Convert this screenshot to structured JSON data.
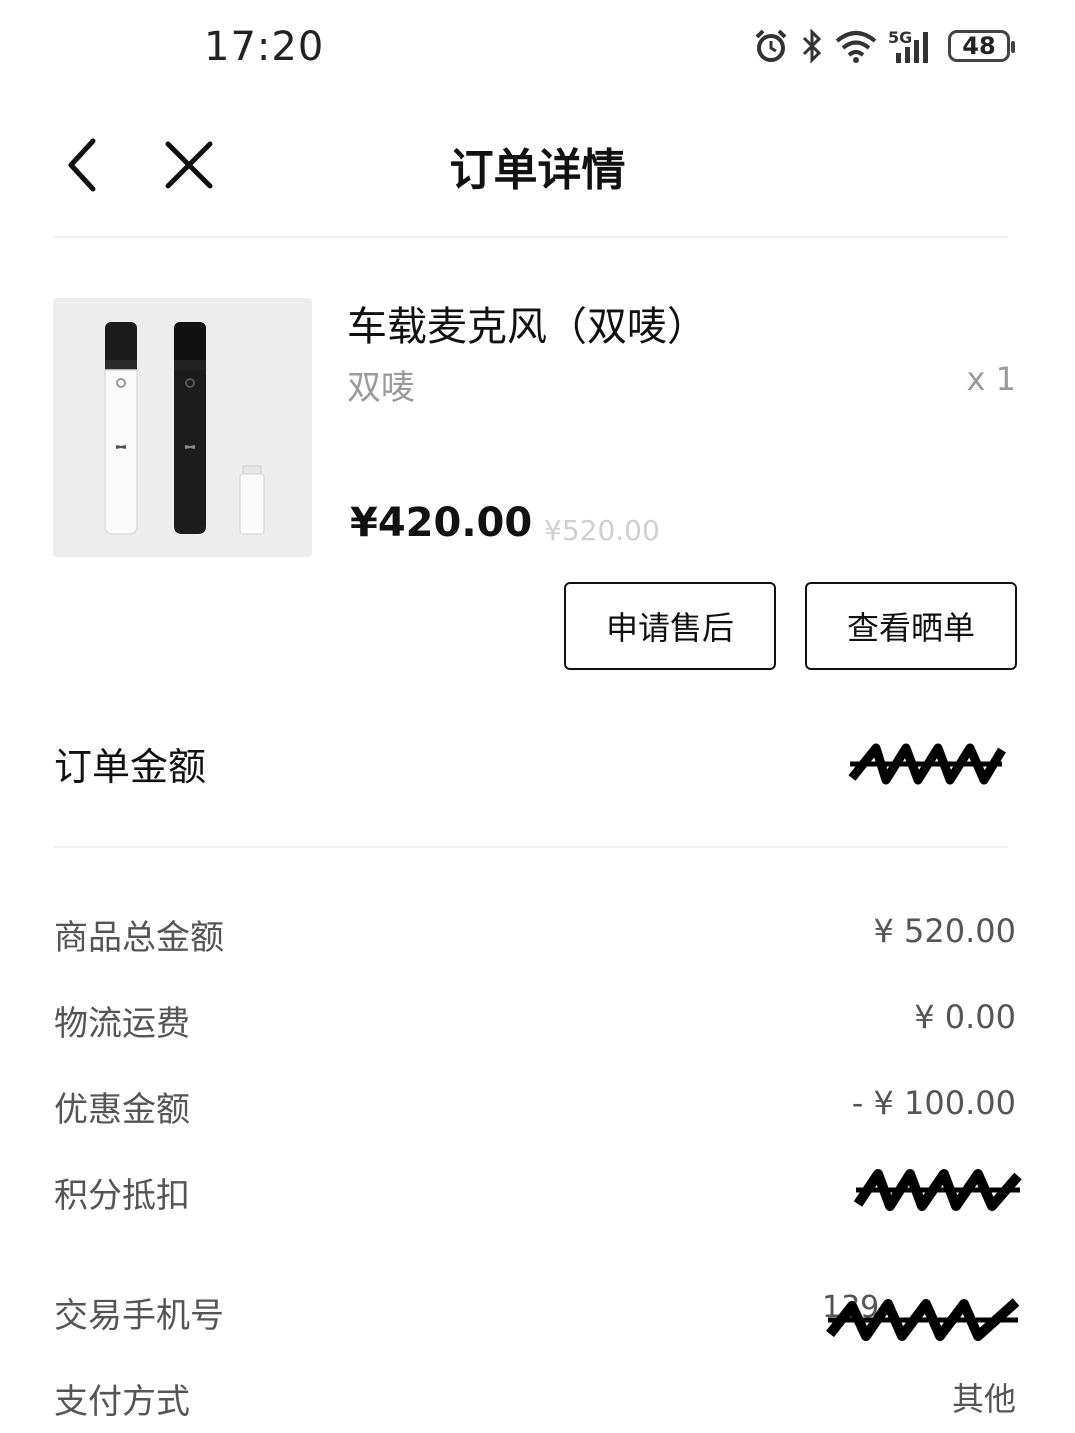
{
  "status_bar": {
    "time": "17:20",
    "network": "5G",
    "battery": "48",
    "icons": [
      "alarm-icon",
      "bluetooth-icon",
      "wifi-icon",
      "signal-icon",
      "battery-icon"
    ]
  },
  "header": {
    "title": "订单详情",
    "back_icon": "chevron-left-icon",
    "close_icon": "close-icon"
  },
  "product": {
    "name": "车载麦克风（双唛）",
    "variant": "双唛",
    "quantity": "x 1",
    "price": "¥420.00",
    "original_price": "¥520.00",
    "buttons": {
      "after_sale": "申请售后",
      "view_review": "查看晒单"
    }
  },
  "order_amount": {
    "label": "订单金额"
  },
  "details": [
    {
      "label": "商品总金额",
      "value": "¥ 520.00"
    },
    {
      "label": "物流运费",
      "value": "¥ 0.00"
    },
    {
      "label": "优惠金额",
      "value": "- ¥ 100.00"
    },
    {
      "label": "积分抵扣",
      "value": ""
    },
    {
      "label": "交易手机号",
      "value": "139"
    },
    {
      "label": "支付方式",
      "value": "其他"
    }
  ],
  "colors": {
    "text_primary": "#111111",
    "text_secondary": "#555555",
    "text_muted": "#9a9a9a",
    "strikethrough_price": "#cfcfcf",
    "divider": "#eeeeee",
    "image_bg": "#ededed"
  }
}
